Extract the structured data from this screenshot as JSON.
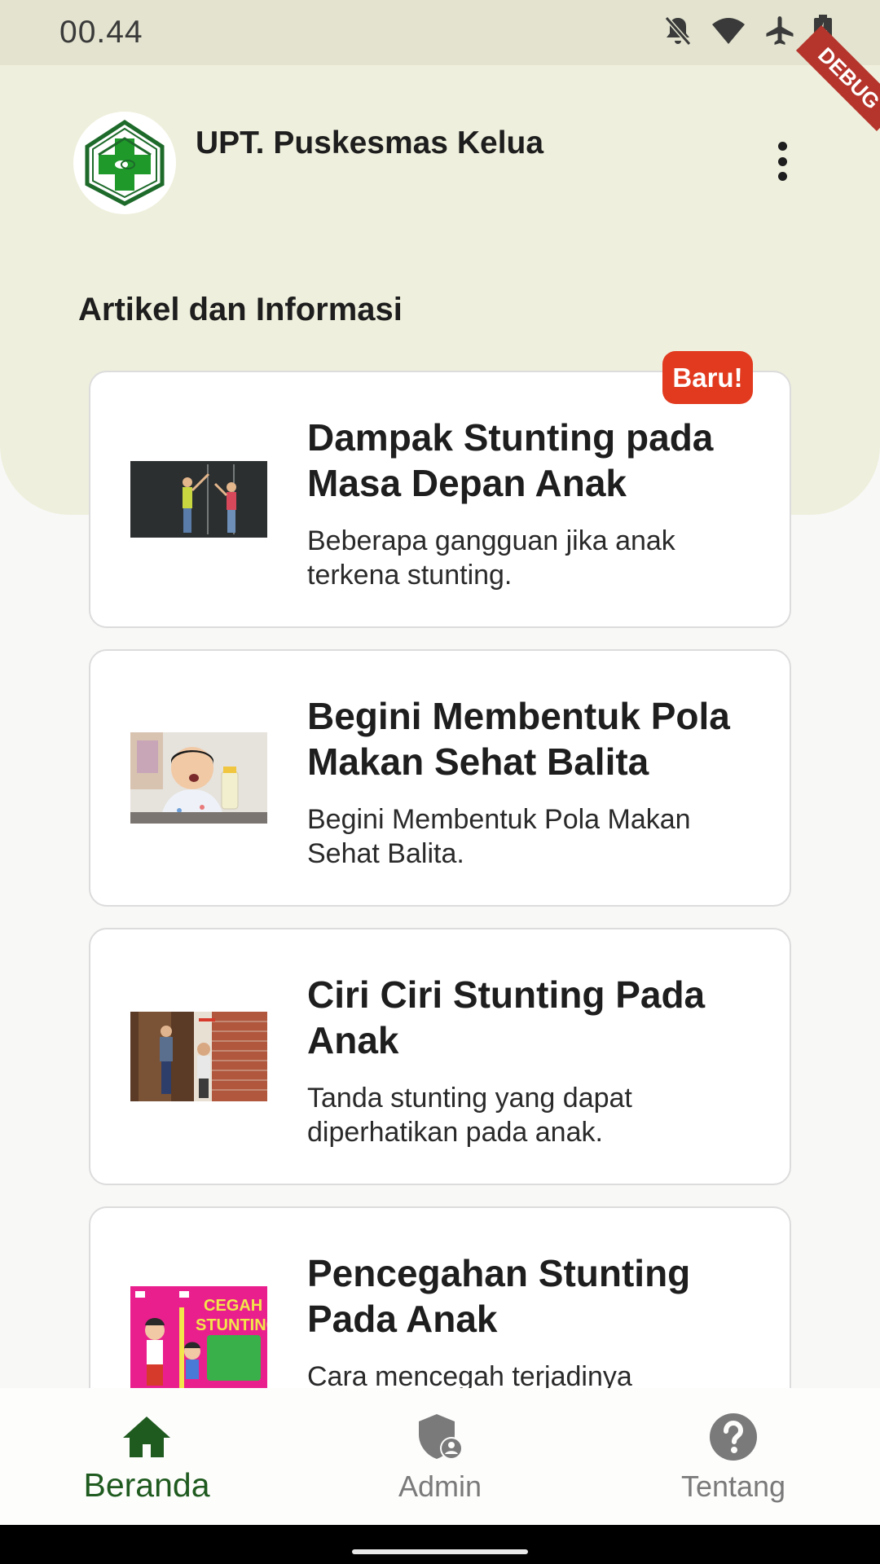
{
  "status_bar": {
    "time": "00.44",
    "icons": [
      "bell-off-icon",
      "wifi-icon",
      "airplane-icon",
      "battery-charging-icon"
    ]
  },
  "header": {
    "title": "UPT. Puskesmas Kelua",
    "debug_banner": "DEBUG",
    "logo": "puskesmas-logo",
    "menu_icon": "more-vertical-icon"
  },
  "section": {
    "title": "Artikel dan Informasi"
  },
  "articles": [
    {
      "title": "Dampak Stunting pada Masa Depan Anak",
      "description": "Beberapa gangguan jika anak terkena stunting.",
      "badge": "Baru!"
    },
    {
      "title": "Begini Membentuk Pola Makan Sehat Balita",
      "description": "Begini Membentuk Pola Makan Sehat Balita."
    },
    {
      "title": "Ciri Ciri Stunting Pada Anak",
      "description": "Tanda stunting yang dapat diperhatikan pada anak."
    },
    {
      "title": "Pencegahan Stunting Pada Anak",
      "description": "Cara mencegah terjadinya",
      "thumb_text": "CEGAH STUNTING"
    }
  ],
  "bottom_nav": {
    "items": [
      {
        "label": "Beranda",
        "icon": "home-icon",
        "active": true
      },
      {
        "label": "Admin",
        "icon": "admin-shield-icon",
        "active": false
      },
      {
        "label": "Tentang",
        "icon": "help-circle-icon",
        "active": false
      }
    ]
  },
  "colors": {
    "header_bg": "#efefdd",
    "status_bar_bg": "#e3e3cf",
    "primary_green": "#1f5a1f",
    "badge_red": "#e13a1e",
    "nav_inactive": "#7a7a7a"
  }
}
